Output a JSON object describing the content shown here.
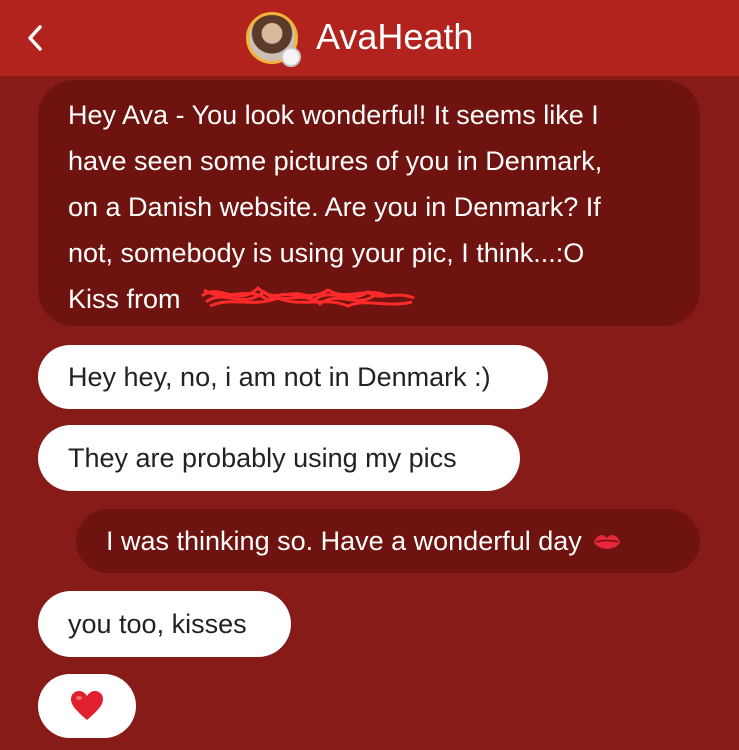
{
  "header": {
    "contact_name": "AvaHeath",
    "back_icon": "chevron-left-icon",
    "avatar_icon": "avatar"
  },
  "colors": {
    "header_bg": "#b3231d",
    "chat_bg": "#871b18",
    "outgoing_bubble": "#6e130f",
    "incoming_bubble": "#ffffff"
  },
  "messages": [
    {
      "direction": "outgoing",
      "lines": [
        "Hey Ava - You look wonderful! It seems like I",
        "have seen some pictures of you in Denmark,",
        "on a Danish website. Are you in Denmark? If",
        "not, somebody is using your pic, I think...:O",
        "Kiss from"
      ],
      "redacted": true
    },
    {
      "direction": "incoming",
      "text": "Hey hey, no, i am not in Denmark :)"
    },
    {
      "direction": "incoming",
      "text": "They are probably using my pics"
    },
    {
      "direction": "outgoing",
      "text": "I was thinking so. Have a wonderful day",
      "icon": "kiss-mark-icon"
    },
    {
      "direction": "incoming",
      "text": "you too, kisses"
    },
    {
      "direction": "incoming",
      "text": "",
      "icon": "red-heart-icon"
    }
  ]
}
